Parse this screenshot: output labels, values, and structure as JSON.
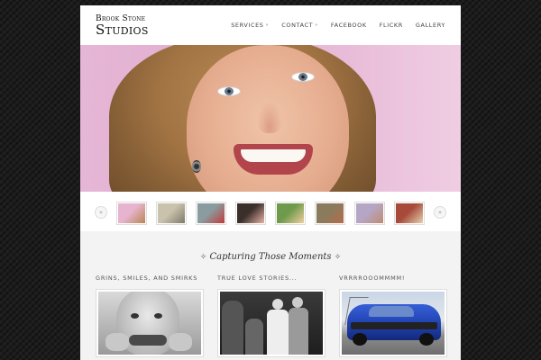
{
  "logo": {
    "line1": "Brook Stone",
    "line2": "Studios"
  },
  "nav": {
    "items": [
      {
        "label": "Services",
        "has_dropdown": true,
        "arrow": "»"
      },
      {
        "label": "Contact",
        "has_dropdown": true,
        "arrow": "»"
      },
      {
        "label": "Facebook",
        "has_dropdown": false
      },
      {
        "label": "Flickr",
        "has_dropdown": false
      },
      {
        "label": "Gallery",
        "has_dropdown": false
      }
    ]
  },
  "slider": {
    "prev_label": "«",
    "next_label": "»",
    "thumbnails": [
      {
        "name": "portrait-woman",
        "colors": [
          "#e7b4cf",
          "#b88650"
        ]
      },
      {
        "name": "outdoor-family",
        "colors": [
          "#c9c2ad",
          "#7f7a68"
        ]
      },
      {
        "name": "dance-red",
        "colors": [
          "#8a9c9f",
          "#c23a3a"
        ]
      },
      {
        "name": "bride-bouquet",
        "colors": [
          "#3b2f2a",
          "#e9b3a8"
        ]
      },
      {
        "name": "child-portrait",
        "colors": [
          "#6f9a4b",
          "#f0cf9e"
        ]
      },
      {
        "name": "group-outdoors",
        "colors": [
          "#8a7b5d",
          "#b46d4a"
        ]
      },
      {
        "name": "couple-pink",
        "colors": [
          "#b5a6c6",
          "#c08a70"
        ]
      },
      {
        "name": "food-dish",
        "colors": [
          "#a74a3a",
          "#e4d2b0"
        ]
      }
    ]
  },
  "tagline": {
    "text": "Capturing Those Moments",
    "flourish_left": "✧",
    "flourish_right": "✧"
  },
  "columns": [
    {
      "title": "Grins, Smiles, and Smirks",
      "image": "child-smirk-bw"
    },
    {
      "title": "True Love Stories...",
      "image": "wedding-couple-bw"
    },
    {
      "title": "Vrrrrooommmm!",
      "image": "blue-mustang"
    }
  ],
  "colors": {
    "page_bg": "#1c1c1c",
    "hero_bg": "#e6b6d6",
    "mustang_blue": "#1f3fae"
  }
}
